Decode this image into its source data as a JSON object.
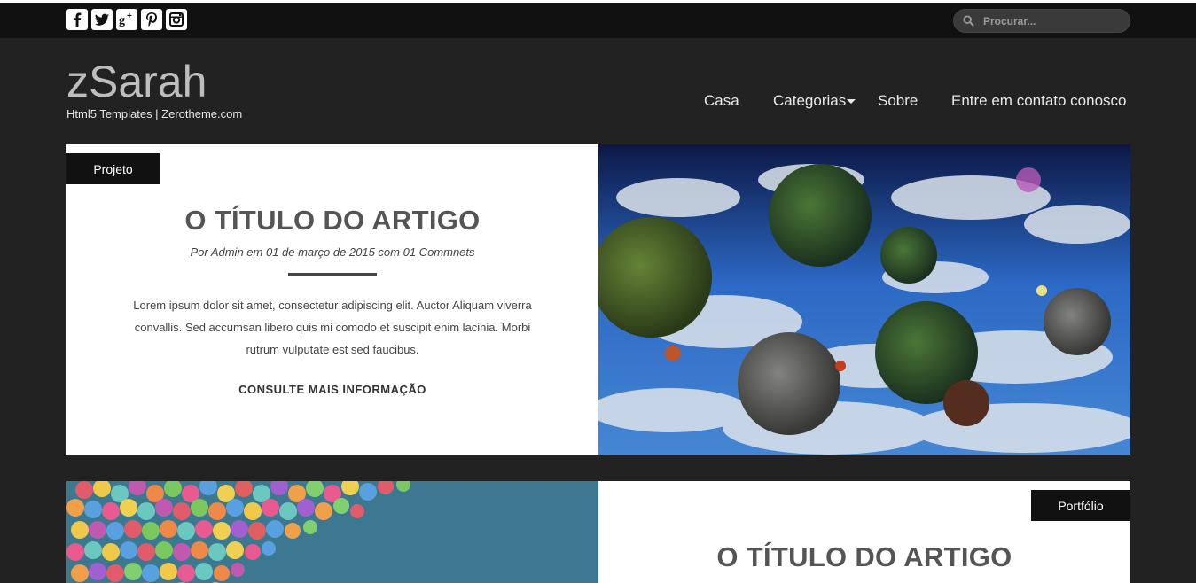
{
  "topbar": {
    "socials": [
      {
        "icon": "facebook-icon",
        "glyph": "f"
      },
      {
        "icon": "twitter-icon",
        "glyph": "t"
      },
      {
        "icon": "googleplus-icon",
        "glyph": "g+"
      },
      {
        "icon": "pinterest-icon",
        "glyph": "p"
      },
      {
        "icon": "instagram-icon",
        "glyph": "ig"
      }
    ],
    "search": {
      "placeholder": "Procurar...",
      "value": ""
    }
  },
  "header": {
    "logo_title": "zSarah",
    "logo_subtitle": "Html5 Templates | Zerotheme.com"
  },
  "nav": {
    "items": [
      {
        "label": "Casa"
      },
      {
        "label": "Categorias",
        "has_dropdown": true
      },
      {
        "label": "Sobre"
      },
      {
        "label": "Entre em contato conosco"
      }
    ]
  },
  "posts": [
    {
      "category": "Projeto",
      "title": "O TÍTULO DO ARTIGO",
      "meta": "Por Admin em 01 de março de 2015 com 01 Commnets",
      "excerpt": "Lorem ipsum dolor sit amet, consectetur adipiscing elit. Auctor Aliquam viverra convallis. Sed accumsan libero quis mi comodo et suscipit enim lacinia. Morbi rutrum vulputate est sed faucibus.",
      "read_more": "CONSULTE MAIS INFORMAÇÃO",
      "image": "floating-planets-sky-image"
    },
    {
      "category": "Portfólio",
      "title": "O TÍTULO DO ARTIGO",
      "image": "balloons-sky-image"
    }
  ],
  "colors": {
    "page_bg": "#222222",
    "topbar_bg": "#111111",
    "card_bg": "#ffffff",
    "tag_bg": "#111111",
    "title_text": "#555555"
  }
}
